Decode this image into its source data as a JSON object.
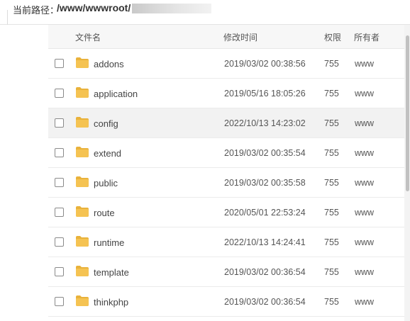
{
  "path": {
    "label": "当前路径：",
    "value": "/www/wwwroot/"
  },
  "table": {
    "columns": {
      "name": "文件名",
      "mtime": "修改时间",
      "perm": "权限",
      "owner": "所有者"
    },
    "rows": [
      {
        "name": "addons",
        "mtime": "2019/03/02 00:38:56",
        "perm": "755",
        "owner": "www"
      },
      {
        "name": "application",
        "mtime": "2019/05/16 18:05:26",
        "perm": "755",
        "owner": "www"
      },
      {
        "name": "config",
        "mtime": "2022/10/13 14:23:02",
        "perm": "755",
        "owner": "www"
      },
      {
        "name": "extend",
        "mtime": "2019/03/02 00:35:54",
        "perm": "755",
        "owner": "www"
      },
      {
        "name": "public",
        "mtime": "2019/03/02 00:35:58",
        "perm": "755",
        "owner": "www"
      },
      {
        "name": "route",
        "mtime": "2020/05/01 22:53:24",
        "perm": "755",
        "owner": "www"
      },
      {
        "name": "runtime",
        "mtime": "2022/10/13 14:24:41",
        "perm": "755",
        "owner": "www"
      },
      {
        "name": "template",
        "mtime": "2019/03/02 00:36:54",
        "perm": "755",
        "owner": "www"
      },
      {
        "name": "thinkphp",
        "mtime": "2019/03/02 00:36:54",
        "perm": "755",
        "owner": "www"
      }
    ]
  },
  "icons": {
    "folder": "folder-icon",
    "checkbox": "checkbox"
  },
  "colors": {
    "folder_body": "#f5c352",
    "folder_back": "#e9b23b",
    "row_hover": "#f2f2f2",
    "header_bg": "#f7f7f7"
  }
}
